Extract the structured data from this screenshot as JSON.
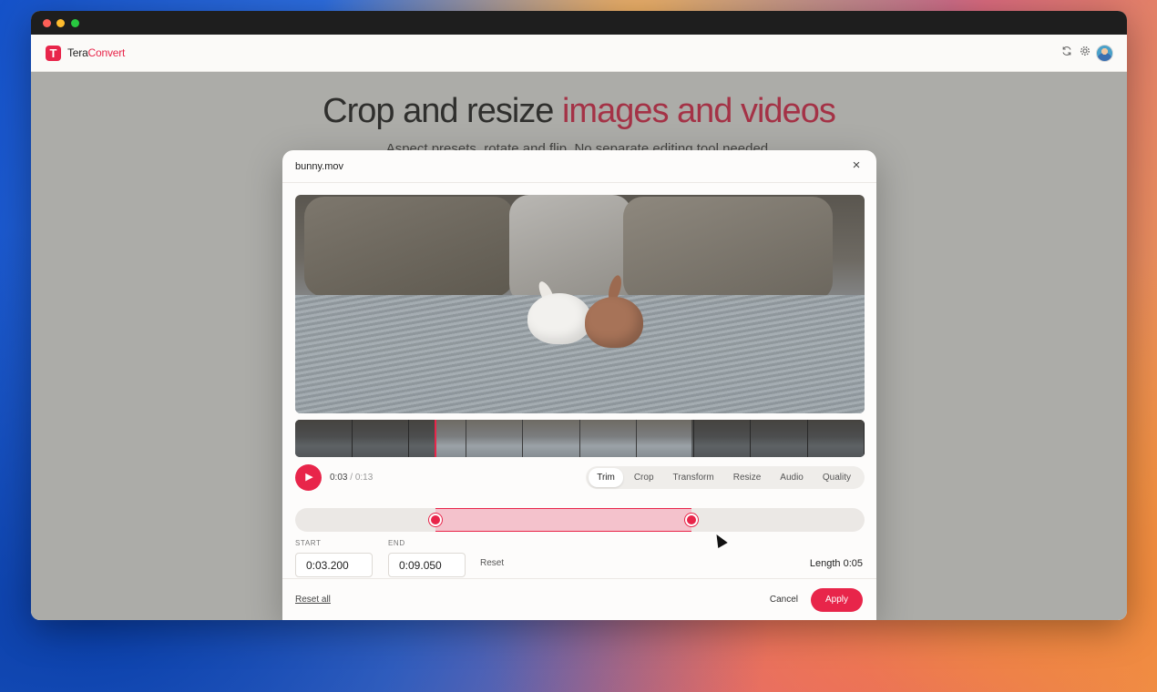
{
  "app": {
    "name_prefix": "Tera",
    "name_accent": "Convert"
  },
  "hero": {
    "title_plain": "Crop and resize ",
    "title_accent": "images and videos",
    "subtitle": "Aspect presets, rotate and flip. No separate editing tool needed."
  },
  "header_icons": [
    "refresh-icon",
    "gear-icon",
    "avatar"
  ],
  "modal": {
    "filename": "bunny.mov",
    "close_icon": "×",
    "time": {
      "current": "0:03",
      "separator": " / ",
      "total": "0:13"
    },
    "tabs": [
      {
        "label": "Trim",
        "active": true
      },
      {
        "label": "Crop",
        "active": false
      },
      {
        "label": "Transform",
        "active": false
      },
      {
        "label": "Resize",
        "active": false
      },
      {
        "label": "Audio",
        "active": false
      },
      {
        "label": "Quality",
        "active": false
      }
    ],
    "trim": {
      "duration_seconds": 13,
      "start_seconds": 3.2,
      "end_seconds": 9.05,
      "playhead_seconds": 3.2
    },
    "start": {
      "label": "START",
      "value": "0:03.200"
    },
    "end": {
      "label": "END",
      "value": "0:09.050"
    },
    "reset_label": "Reset",
    "length_label": "Length 0:05",
    "footer": {
      "reset_all": "Reset all",
      "cancel": "Cancel",
      "apply": "Apply"
    }
  },
  "colors": {
    "accent": "#e8254a",
    "accent_soft": "#f4c2cc"
  }
}
